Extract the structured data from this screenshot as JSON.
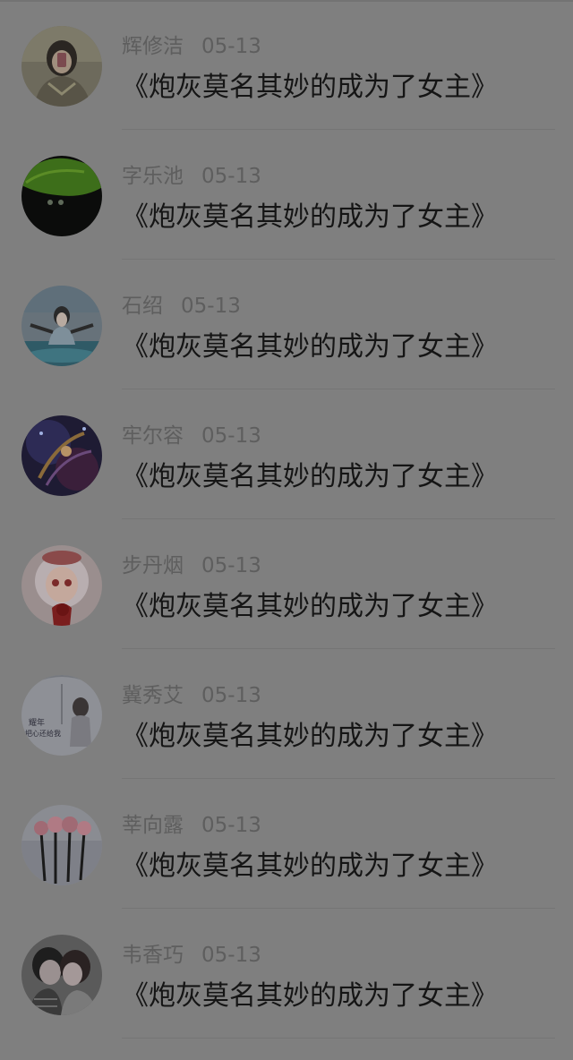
{
  "comments": [
    {
      "name": "辉修洁",
      "date": "05-13",
      "text": "《炮灰莫名其妙的成为了女主》",
      "avatar_icon": "user-avatar-girl-selfie"
    },
    {
      "name": "字乐池",
      "date": "05-13",
      "text": "《炮灰莫名其妙的成为了女主》",
      "avatar_icon": "user-avatar-green-leaf"
    },
    {
      "name": "石绍",
      "date": "05-13",
      "text": "《炮灰莫名其妙的成为了女主》",
      "avatar_icon": "user-avatar-girl-sea"
    },
    {
      "name": "牢尔容",
      "date": "05-13",
      "text": "《炮灰莫名其妙的成为了女主》",
      "avatar_icon": "user-avatar-dark-anime"
    },
    {
      "name": "步丹烟",
      "date": "05-13",
      "text": "《炮灰莫名其妙的成为了女主》",
      "avatar_icon": "user-avatar-anime-girl"
    },
    {
      "name": "冀秀艾",
      "date": "05-13",
      "text": "《炮灰莫名其妙的成为了女主》",
      "avatar_icon": "user-avatar-umbrella-girl",
      "avatar_text": [
        "耀年",
        "把心还给我"
      ]
    },
    {
      "name": "莘向露",
      "date": "05-13",
      "text": "《炮灰莫名其妙的成为了女主》",
      "avatar_icon": "user-avatar-roses"
    },
    {
      "name": "韦香巧",
      "date": "05-13",
      "text": "《炮灰莫名其妙的成为了女主》",
      "avatar_icon": "user-avatar-couple"
    }
  ]
}
